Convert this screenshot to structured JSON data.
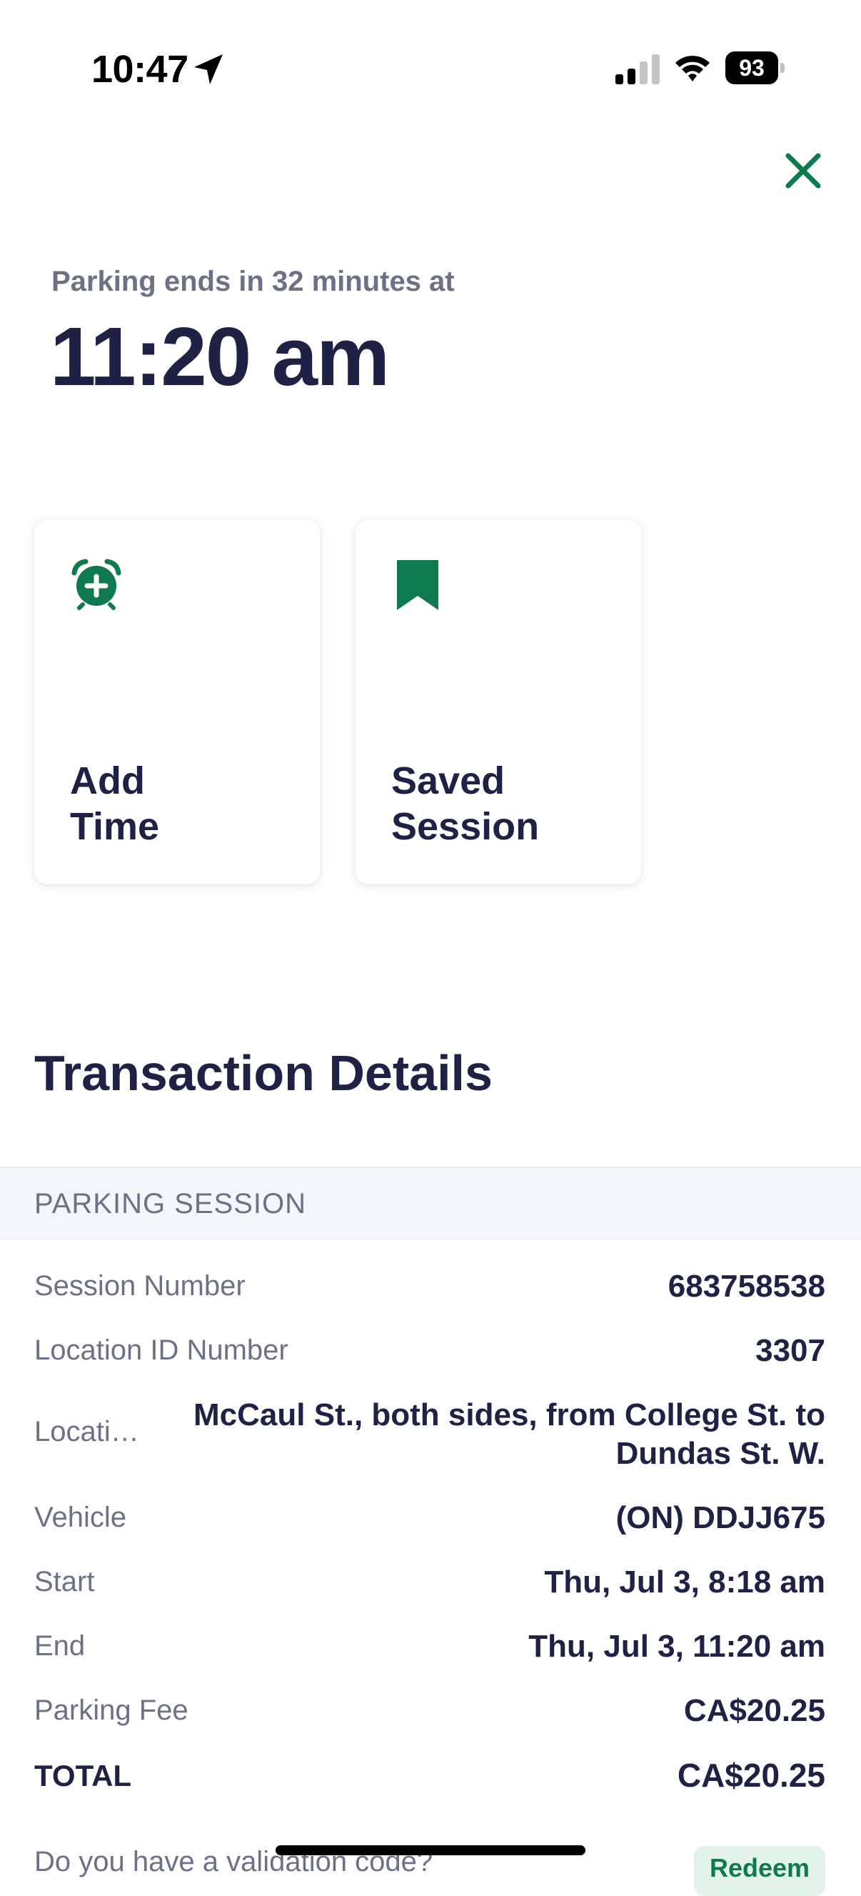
{
  "status_bar": {
    "time": "10:47",
    "battery": "93"
  },
  "header": {
    "ends_label": "Parking ends in 32 minutes at",
    "ends_time": "11:20 am"
  },
  "actions": [
    {
      "label": "Add\nTime",
      "icon": "alarm-add-icon"
    },
    {
      "label": "Saved\nSession",
      "icon": "bookmark-icon"
    }
  ],
  "transaction": {
    "title": "Transaction Details",
    "section": "PARKING SESSION",
    "rows": [
      {
        "label": "Session Number",
        "value": "683758538"
      },
      {
        "label": "Location ID Number",
        "value": "3307"
      },
      {
        "label": "Locati…",
        "value": "McCaul St., both sides, from College St. to Dundas St. W."
      },
      {
        "label": "Vehicle",
        "value": "(ON) DDJJ675"
      },
      {
        "label": "Start",
        "value": "Thu, Jul 3, 8:18 am"
      },
      {
        "label": "End",
        "value": "Thu, Jul 3, 11:20 am"
      },
      {
        "label": "Parking Fee",
        "value": "CA$20.25"
      }
    ],
    "total": {
      "label": "TOTAL",
      "value": "CA$20.25"
    }
  },
  "validation": {
    "question": "Do you have a validation code?",
    "button": "Redeem"
  },
  "colors": {
    "brand_green": "#0f7a4f",
    "text_dark": "#1f2244",
    "text_muted": "#6e7085"
  }
}
